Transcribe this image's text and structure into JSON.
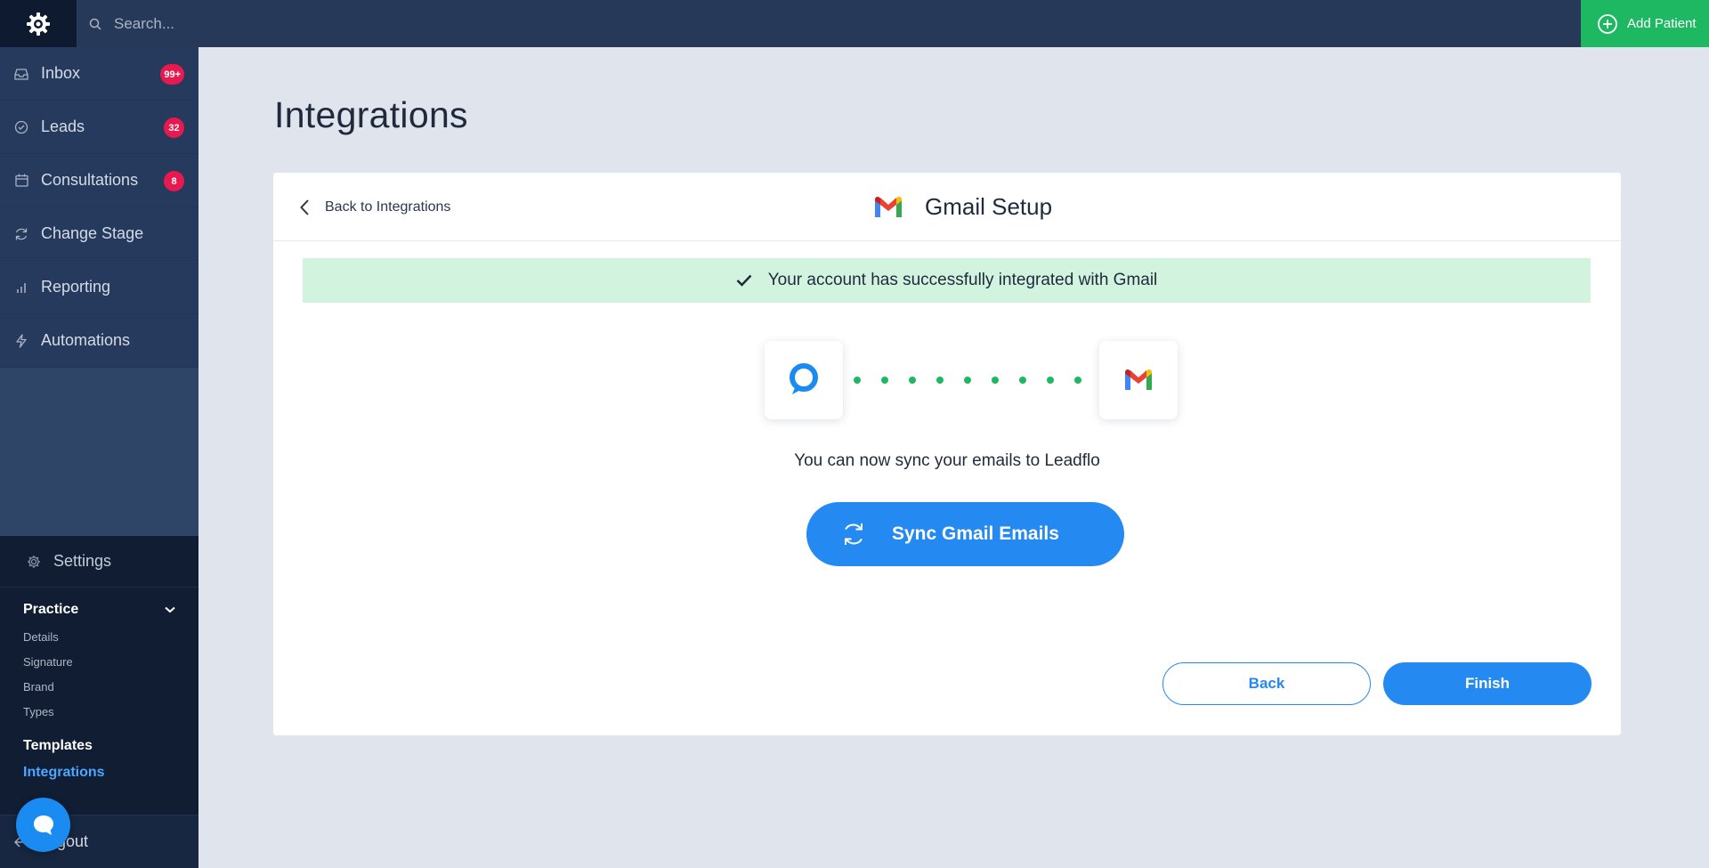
{
  "topbar": {
    "search_placeholder": "Search...",
    "add_patient_label": "Add Patient"
  },
  "sidebar": {
    "items": [
      {
        "label": "Inbox",
        "icon": "inbox-icon",
        "badge": "99+"
      },
      {
        "label": "Leads",
        "icon": "check-circle-icon",
        "badge": "32"
      },
      {
        "label": "Consultations",
        "icon": "calendar-icon",
        "badge": "8"
      },
      {
        "label": "Change Stage",
        "icon": "refresh-icon"
      },
      {
        "label": "Reporting",
        "icon": "bar-chart-icon"
      },
      {
        "label": "Automations",
        "icon": "lightning-icon"
      }
    ],
    "settings": {
      "label": "Settings",
      "practice_label": "Practice",
      "practice_items": [
        "Details",
        "Signature",
        "Brand",
        "Types"
      ],
      "templates_label": "Templates",
      "integrations_label": "Integrations"
    },
    "logout_label": "Logout"
  },
  "main": {
    "page_title": "Integrations",
    "back_link": "Back to Integrations",
    "setup_title": "Gmail Setup",
    "success_message": "Your account has successfully integrated with Gmail",
    "sync_text": "You can now sync your emails to Leadflo",
    "sync_button": "Sync Gmail Emails",
    "back_button": "Back",
    "finish_button": "Finish"
  },
  "colors": {
    "accent": "#2589f2",
    "success_green": "#1fb862",
    "badge_red": "#e8194e",
    "topbar": "#263959",
    "sidebar": "#2e4568"
  }
}
